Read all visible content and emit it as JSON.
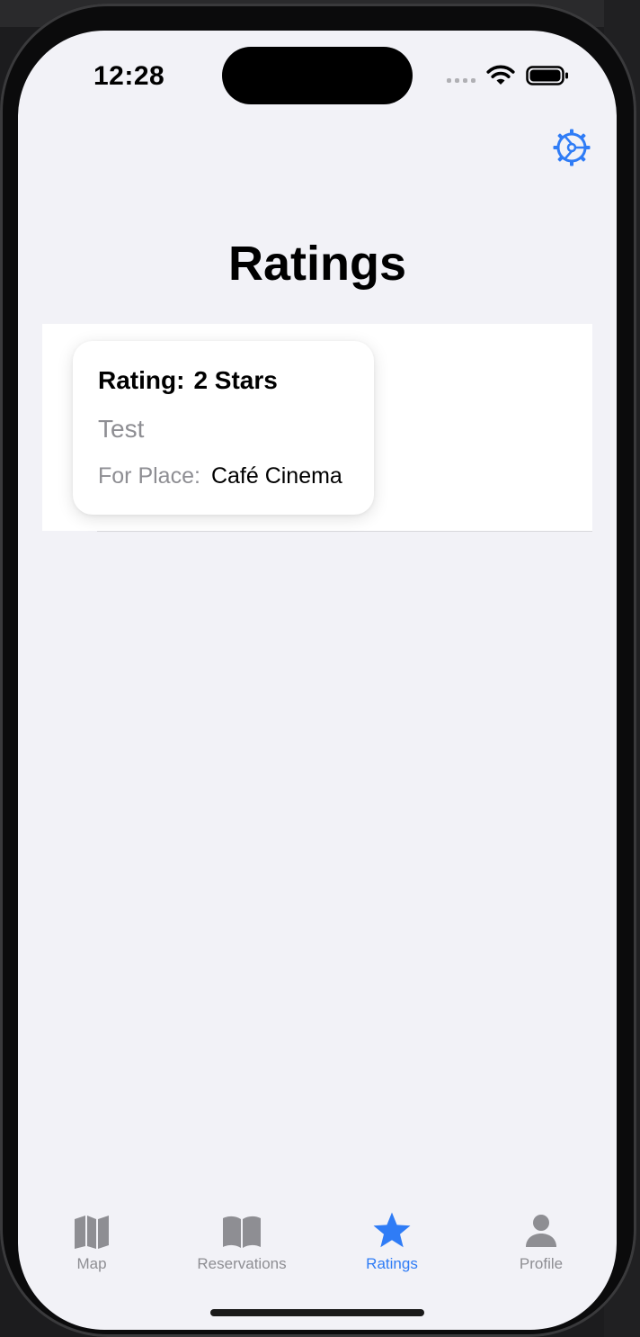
{
  "status_bar": {
    "time": "12:28"
  },
  "nav": {
    "settings_icon": "gear-icon"
  },
  "page": {
    "title": "Ratings"
  },
  "ratings": [
    {
      "rating_label": "Rating:",
      "rating_value": "2 Stars",
      "comment": "Test",
      "place_label": "For Place:",
      "place_name": "Café Cinema"
    }
  ],
  "tabs": [
    {
      "label": "Map",
      "icon": "map-icon",
      "active": false
    },
    {
      "label": "Reservations",
      "icon": "book-icon",
      "active": false
    },
    {
      "label": "Ratings",
      "icon": "star-icon",
      "active": true
    },
    {
      "label": "Profile",
      "icon": "person-icon",
      "active": false
    }
  ],
  "colors": {
    "accent": "#2f7cf6",
    "inactive": "#8e8e93",
    "background": "#f2f2f7"
  }
}
